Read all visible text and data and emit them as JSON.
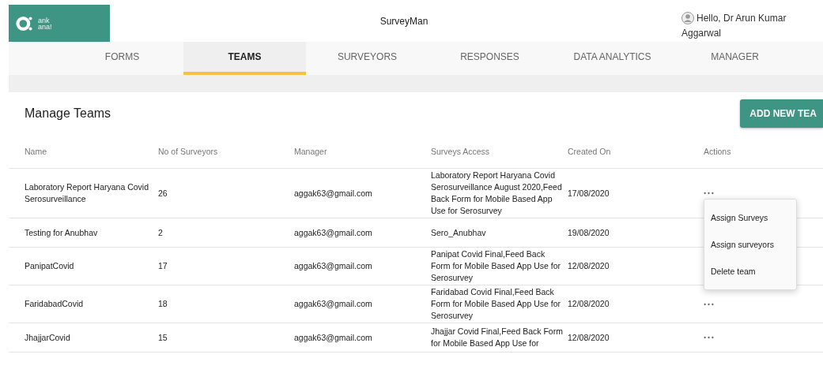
{
  "header": {
    "logo_text": "ank\nana!",
    "title": "SurveyMan",
    "greeting": "Hello, Dr Arun Kumar",
    "user_line2": "Aggarwal"
  },
  "tabs": [
    {
      "label": "FORMS",
      "selected": false
    },
    {
      "label": "TEAMS",
      "selected": true
    },
    {
      "label": "SURVEYORS",
      "selected": false
    },
    {
      "label": "RESPONSES",
      "selected": false
    },
    {
      "label": "DATA ANALYTICS",
      "selected": false
    },
    {
      "label": "MANAGER",
      "selected": false
    }
  ],
  "page_title": "Manage Teams",
  "add_button": "ADD NEW TEA",
  "table": {
    "columns": [
      "Name",
      "No of Surveyors",
      "Manager",
      "Surveys Access",
      "Created On",
      "Actions"
    ],
    "rows": [
      {
        "name": "Laboratory Report Haryana Covid Serosurveillance",
        "surveyors": "26",
        "manager": "aggak63@gmail.com",
        "access": "Laboratory Report Haryana Covid Serosurveillance August 2020,Feed Back Form for Mobile Based App Use for Serosurvey",
        "created": "17/08/2020",
        "menu_open": true
      },
      {
        "name": "Testing for Anubhav",
        "surveyors": "2",
        "manager": "aggak63@gmail.com",
        "access": "Sero_Anubhav",
        "created": "19/08/2020",
        "menu_open": false
      },
      {
        "name": "PanipatCovid",
        "surveyors": "17",
        "manager": "aggak63@gmail.com",
        "access": "Panipat Covid Final,Feed Back Form for Mobile Based App Use for Serosurvey",
        "created": "12/08/2020",
        "menu_open": false
      },
      {
        "name": "FaridabadCovid",
        "surveyors": "18",
        "manager": "aggak63@gmail.com",
        "access": "Faridabad Covid Final,Feed Back Form for Mobile Based App Use for Serosurvey",
        "created": "12/08/2020",
        "menu_open": false
      },
      {
        "name": "JhajjarCovid",
        "surveyors": "15",
        "manager": "aggak63@gmail.com",
        "access": "Jhajjar Covid Final,Feed Back Form for Mobile Based App Use for",
        "created": "12/08/2020",
        "menu_open": false
      }
    ]
  },
  "actions_menu_items": [
    "Assign Surveys",
    "Assign surveyors",
    "Delete team"
  ]
}
